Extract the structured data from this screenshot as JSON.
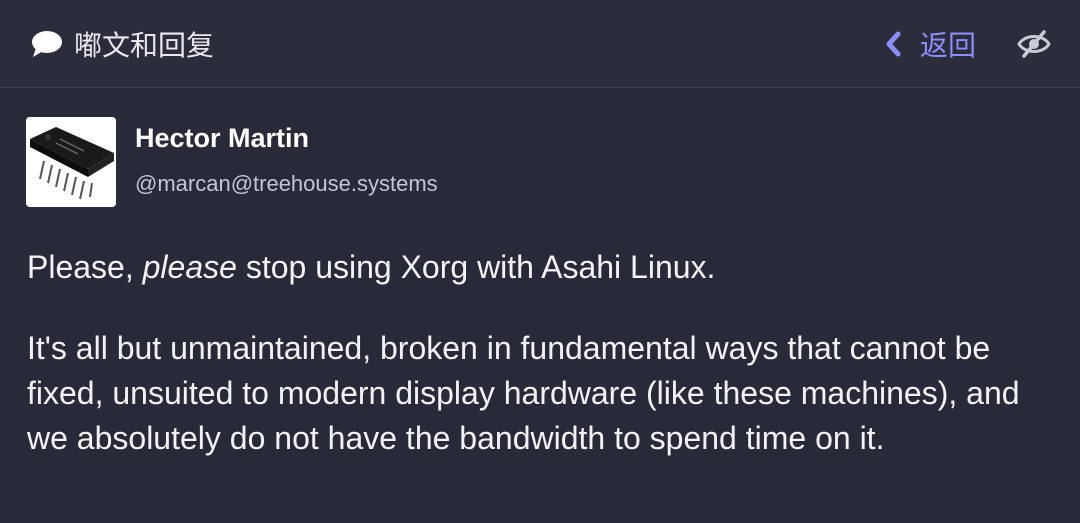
{
  "header": {
    "title": "嘟文和回复",
    "title_icon": "chat-bubble-icon",
    "back_label": "返回",
    "back_icon": "chevron-left-icon",
    "visibility_icon": "eye-slash-icon"
  },
  "status": {
    "display_name": "Hector Martin",
    "handle": "@marcan@treehouse.systems",
    "avatar_icon": "microchip-avatar",
    "paragraph1": {
      "before": "Please, ",
      "emphasis": "please",
      "after": " stop using Xorg with Asahi Linux."
    },
    "paragraph2": "It's all but unmaintained, broken in fundamental ways that cannot be fixed, unsuited to modern display hardware (like these machines), and we absolutely do not have the bandwidth to spend time on it."
  },
  "colors": {
    "background": "#282a37",
    "header_bg": "#2b2d3b",
    "accent": "#8c8dff",
    "text": "#f2f3f8",
    "muted": "#c4c6d4"
  }
}
